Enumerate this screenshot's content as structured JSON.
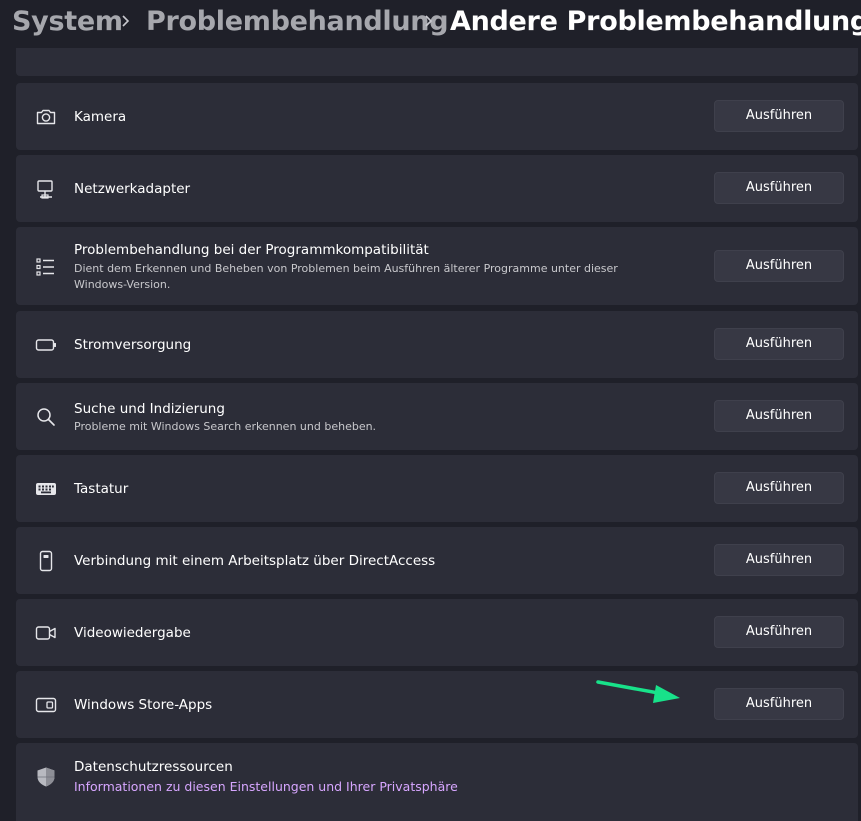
{
  "breadcrumb": {
    "system": "System",
    "troubleshoot": "Problembehandlung",
    "current": "Andere Problembehandlungen"
  },
  "run_label": "Ausführen",
  "rows": [
    {
      "title": "Kamera",
      "icon": "camera-icon"
    },
    {
      "title": "Netzwerkadapter",
      "icon": "network-adapter-icon"
    },
    {
      "title": "Problembehandlung bei der Programmkompatibilität",
      "desc": "Dient dem Erkennen und Beheben von Problemen beim Ausführen älterer Programme unter dieser Windows-Version.",
      "icon": "list-icon"
    },
    {
      "title": "Stromversorgung",
      "icon": "battery-icon"
    },
    {
      "title": "Suche und Indizierung",
      "desc": "Probleme mit Windows Search erkennen und beheben.",
      "icon": "search-icon"
    },
    {
      "title": "Tastatur",
      "icon": "keyboard-icon"
    },
    {
      "title": "Verbindung mit einem Arbeitsplatz über DirectAccess",
      "icon": "phone-icon"
    },
    {
      "title": "Videowiedergabe",
      "icon": "video-icon"
    },
    {
      "title": "Windows Store-Apps",
      "icon": "store-apps-icon"
    }
  ],
  "privacy": {
    "title": "Datenschutzressourcen",
    "link": "Informationen zu diesen Einstellungen und Ihrer Privatsphäre",
    "icon": "shield-icon"
  },
  "colors": {
    "background": "#1f2029",
    "card": "#2c2d38",
    "button": "#373844",
    "link": "#d7a6ff",
    "annotation_arrow": "#18e28a"
  }
}
